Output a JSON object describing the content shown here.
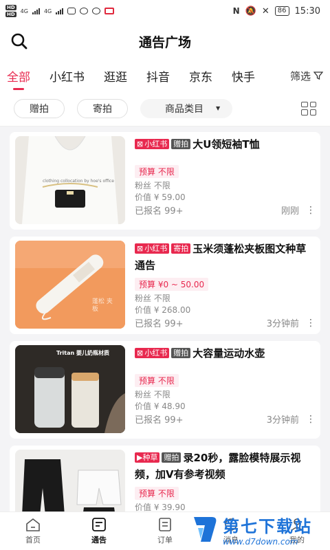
{
  "status_bar": {
    "hd1": "HD",
    "hd2": "HD",
    "net1": "4G",
    "net2": "4G",
    "battery": "86",
    "time": "15:30"
  },
  "header": {
    "title": "通告广场"
  },
  "tabs": [
    {
      "label": "全部",
      "active": true
    },
    {
      "label": "小红书"
    },
    {
      "label": "逛逛"
    },
    {
      "label": "抖音"
    },
    {
      "label": "京东"
    },
    {
      "label": "快手"
    }
  ],
  "filter_label": "筛选",
  "filters": {
    "gift": "赠拍",
    "mail": "寄拍",
    "category": "商品类目"
  },
  "cards": [
    {
      "platform": "小红书",
      "type": "赠拍",
      "title": "大U领短袖T恤",
      "budget": "预算 不限",
      "fans": "粉丝 不限",
      "price": "价值 ¥ 59.00",
      "signed": "已报名 99+",
      "time": "刚刚",
      "thumb_text": "clothing collocation by hoe's office"
    },
    {
      "platform": "小红书",
      "type": "寄拍",
      "title": "玉米须蓬松夹板图文种草通告",
      "budget": "预算 ¥0 ~ 50.00",
      "fans": "粉丝 不限",
      "price": "价值 ¥ 268.00",
      "signed": "已报名 99+",
      "time": "3分钟前",
      "thumb_text": "蓬松 夹板"
    },
    {
      "platform": "小红书",
      "type": "赠拍",
      "title": "大容量运动水壶",
      "budget": "预算 不限",
      "fans": "粉丝 不限",
      "price": "价值 ¥ 48.90",
      "signed": "已报名 99+",
      "time": "3分钟前",
      "thumb_text": "Tritan 婴儿奶瓶材质"
    },
    {
      "platform": "种草",
      "type": "赠拍",
      "title": "录20秒，露脸模特展示视频，加V有参考视频",
      "budget": "预算 不限",
      "fans": "",
      "price": "价值 ¥ 39.90",
      "signed": "",
      "time": "",
      "thumb_text": ""
    }
  ],
  "tabbar": [
    {
      "label": "首页",
      "icon": "home-icon"
    },
    {
      "label": "通告",
      "icon": "notice-icon",
      "active": true
    },
    {
      "label": "订单",
      "icon": "order-icon"
    },
    {
      "label": "消息",
      "icon": "message-icon"
    },
    {
      "label": "我的",
      "icon": "profile-icon"
    }
  ],
  "watermark": {
    "cn": "第七下载站",
    "url": "www.d7down.com"
  },
  "colors": {
    "accent": "#e8294f",
    "watermark": "#1e73d8"
  }
}
